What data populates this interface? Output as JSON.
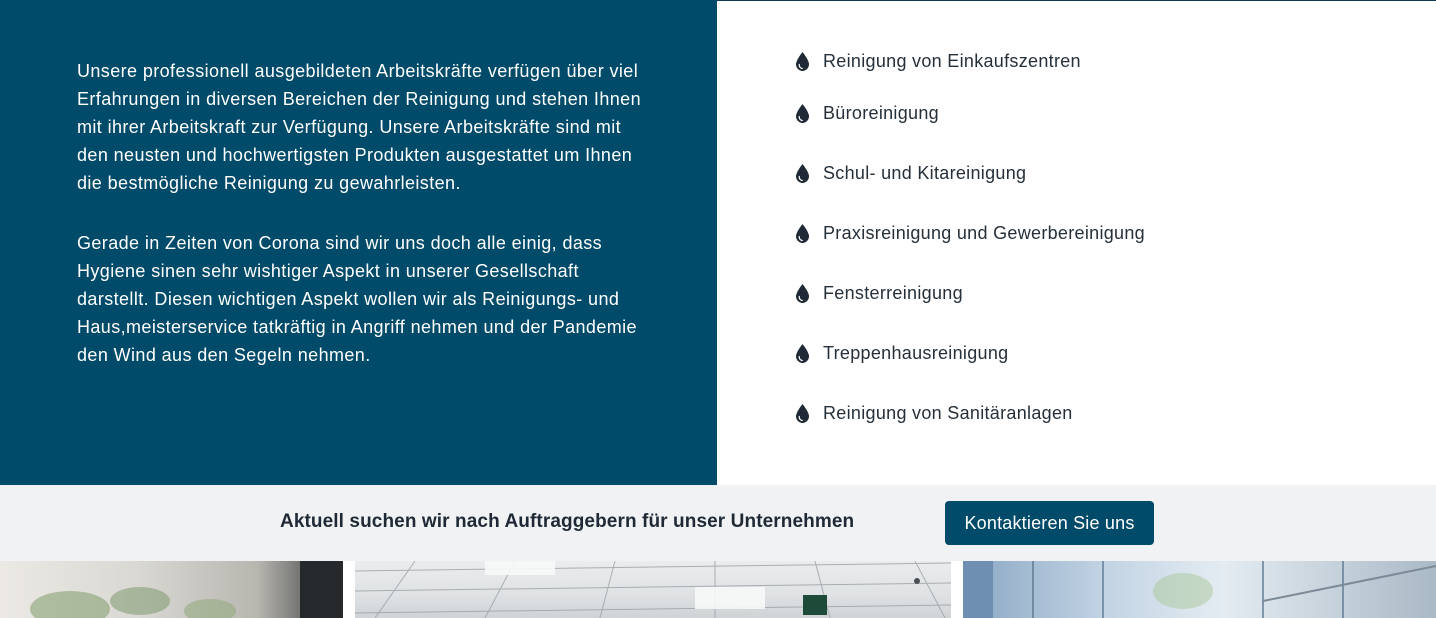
{
  "about": {
    "paragraph_1": "Unsere professionell ausgebildeten Arbeitskräfte verfügen über viel Erfahrungen in diversen Bereichen der Reinigung und stehen Ihnen mit ihrer Arbeitskraft zur Verfügung. Unsere Arbeitskräfte sind mit den neusten und hochwertigsten Produkten ausgestattet um Ihnen die bestmögliche Reinigung zu gewahrleisten.",
    "paragraph_2": "Gerade in Zeiten von Corona sind wir uns doch alle einig, dass Hygiene sinen sehr wishtiger Aspekt in unserer Gesellschaft darstellt. Diesen wichtigen Aspekt wollen wir als Reinigungs- und Haus,meisterservice tatkräftig in Angriff nehmen und der Pandemie den Wind aus den Segeln nehmen."
  },
  "services": {
    "icon": "water-drop-icon",
    "items": [
      {
        "label": "Reinigung von Einkaufszentren"
      },
      {
        "label": "Büroreinigung"
      },
      {
        "label": "Schul- und Kitareinigung"
      },
      {
        "label": "Praxisreinigung und Gewerbereinigung"
      },
      {
        "label": "Fensterreinigung"
      },
      {
        "label": "Treppenhausreinigung"
      },
      {
        "label": "Reinigung von Sanitäranlagen"
      }
    ]
  },
  "cta": {
    "text": "Aktuell suchen wir nach Auftraggebern für unser Unternehmen",
    "button_label": "Kontaktieren Sie uns"
  },
  "colors": {
    "primary": "#004a6a",
    "text_dark": "#25303a",
    "cta_background": "#f1f2f3"
  }
}
